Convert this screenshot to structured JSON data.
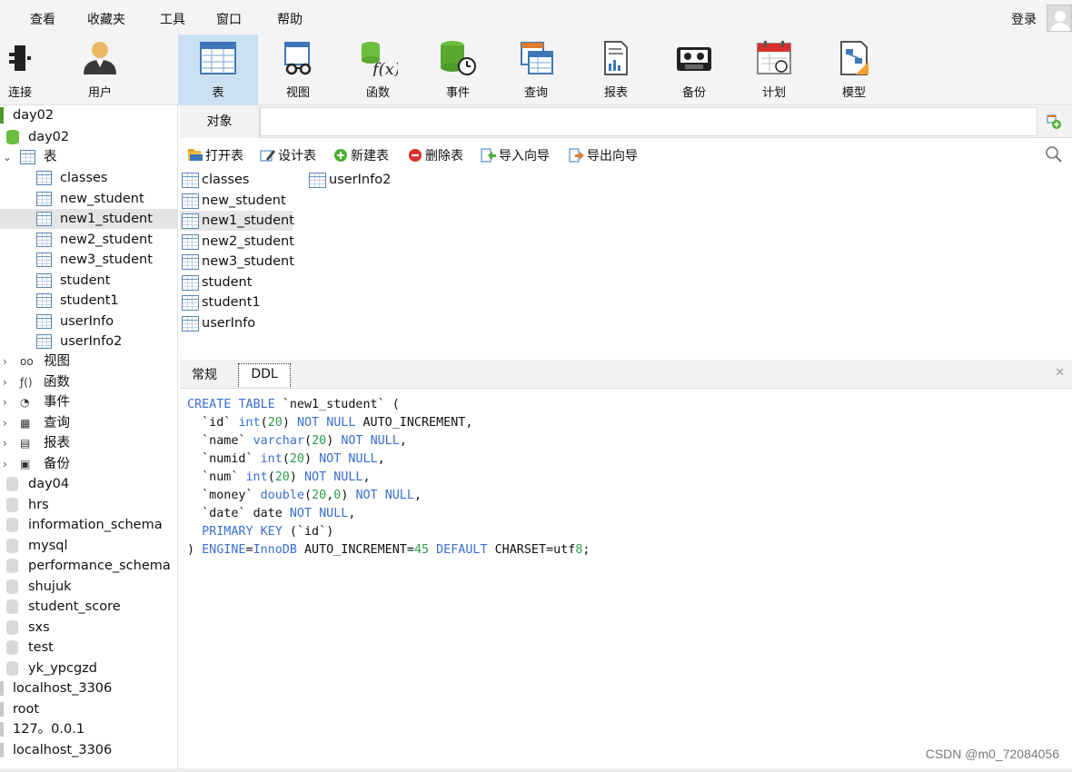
{
  "menu": {
    "items": [
      "查看",
      "收藏夹",
      "工具",
      "窗口",
      "帮助"
    ],
    "login": "登录"
  },
  "toolbar": {
    "buttons": [
      {
        "label": "连接",
        "icon": "connect-icon"
      },
      {
        "label": "用户",
        "icon": "user-icon"
      },
      {
        "label": "表",
        "icon": "table-icon",
        "active": true
      },
      {
        "label": "视图",
        "icon": "view-icon"
      },
      {
        "label": "函数",
        "icon": "function-icon"
      },
      {
        "label": "事件",
        "icon": "event-icon"
      },
      {
        "label": "查询",
        "icon": "query-icon"
      },
      {
        "label": "报表",
        "icon": "report-icon"
      },
      {
        "label": "备份",
        "icon": "backup-icon"
      },
      {
        "label": "计划",
        "icon": "schedule-icon"
      },
      {
        "label": "模型",
        "icon": "model-icon"
      }
    ]
  },
  "sidebar": {
    "connection": "day02",
    "database": "day02",
    "tables_group": "表",
    "tables": [
      "classes",
      "new_student",
      "new1_student",
      "new2_student",
      "new3_student",
      "student",
      "student1",
      "userInfo",
      "userInfo2"
    ],
    "selected_table": "new1_student",
    "groups": [
      "视图",
      "函数",
      "事件",
      "查询",
      "报表",
      "备份"
    ],
    "databases": [
      "day04",
      "hrs",
      "information_schema",
      "mysql",
      "performance_schema",
      "shujuk",
      "student_score",
      "sxs",
      "test",
      "yk_ypcgzd"
    ],
    "connections": [
      "localhost_3306",
      "root",
      "127。0.0.1",
      "localhost_3306"
    ]
  },
  "main": {
    "object_tab": "对象",
    "actions": [
      "打开表",
      "设计表",
      "新建表",
      "删除表",
      "导入向导",
      "导出向导"
    ],
    "objects_col1": [
      "classes",
      "new_student",
      "new1_student",
      "new2_student",
      "new3_student",
      "student",
      "student1",
      "userInfo"
    ],
    "objects_col2": [
      "userInfo2"
    ],
    "selected_object": "new1_student"
  },
  "bottom": {
    "tabs": [
      "常规",
      "DDL"
    ],
    "active_tab": "DDL",
    "ddl_lines": [
      "CREATE TABLE `new1_student` (",
      "  `id` int(20) NOT NULL AUTO_INCREMENT,",
      "  `name` varchar(20) NOT NULL,",
      "  `numid` int(20) NOT NULL,",
      "  `num` int(20) NOT NULL,",
      "  `money` double(20,0) NOT NULL,",
      "  `date` date NOT NULL,",
      "  PRIMARY KEY (`id`)",
      ") ENGINE=InnoDB AUTO_INCREMENT=45 DEFAULT CHARSET=utf8;"
    ]
  },
  "watermark": "CSDN @m0_72084056",
  "colors": {
    "active_toolbar": "#cce0f3",
    "keyword": "#3b6fd4",
    "number": "#2e9b4b",
    "selected_row": "#e4e4e4"
  }
}
